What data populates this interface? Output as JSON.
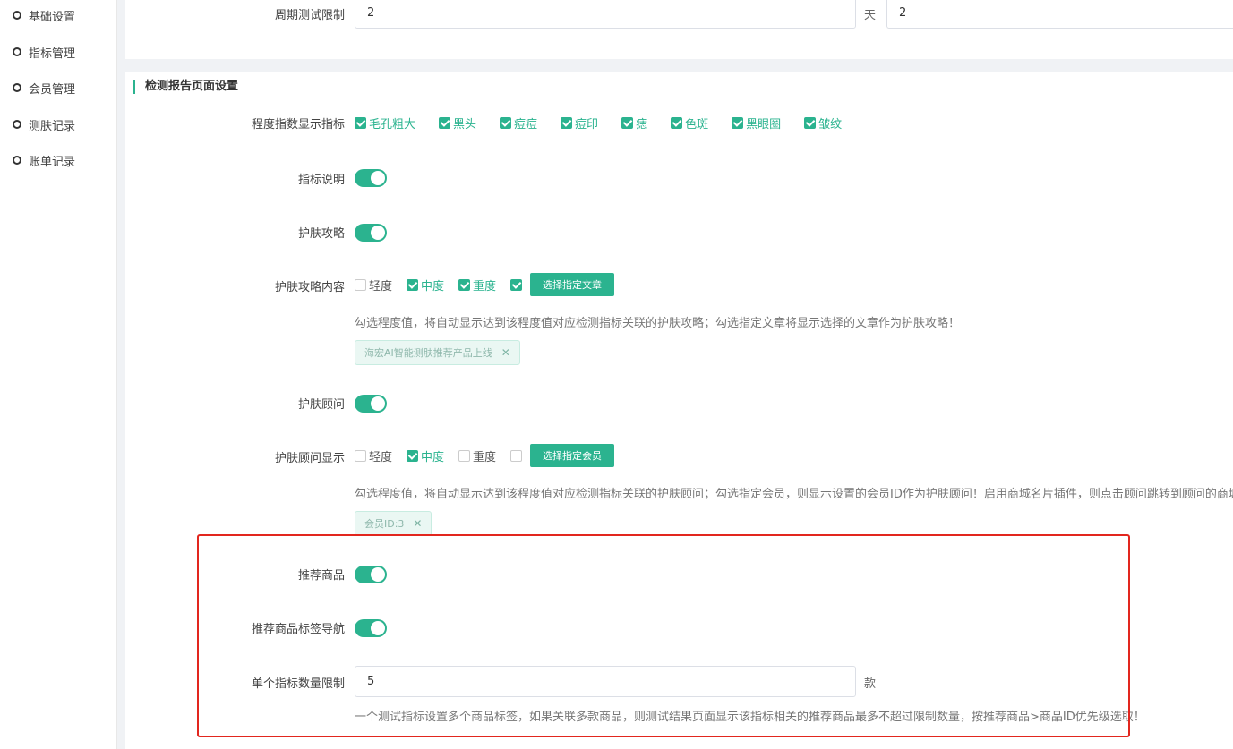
{
  "sidebar": {
    "items": [
      {
        "label": "基础设置"
      },
      {
        "label": "指标管理"
      },
      {
        "label": "会员管理"
      },
      {
        "label": "测肤记录"
      },
      {
        "label": "账单记录"
      }
    ]
  },
  "cycle_limit": {
    "label": "周期测试限制",
    "days_value": "2",
    "unit": "天",
    "count_value": "2"
  },
  "report": {
    "section_title": "检测报告页面设置",
    "degree_index": {
      "label": "程度指数显示指标",
      "options": [
        {
          "label": "毛孔粗大",
          "checked": true
        },
        {
          "label": "黑头",
          "checked": true
        },
        {
          "label": "痘痘",
          "checked": true
        },
        {
          "label": "痘印",
          "checked": true
        },
        {
          "label": "痣",
          "checked": true
        },
        {
          "label": "色斑",
          "checked": true
        },
        {
          "label": "黑眼圈",
          "checked": true
        },
        {
          "label": "皱纹",
          "checked": true
        }
      ]
    },
    "index_desc": {
      "label": "指标说明",
      "on": true
    },
    "skincare_guide": {
      "label": "护肤攻略",
      "on": true
    },
    "guide_content": {
      "label": "护肤攻略内容",
      "options": [
        {
          "label": "轻度",
          "checked": false
        },
        {
          "label": "中度",
          "checked": true
        },
        {
          "label": "重度",
          "checked": true
        }
      ],
      "custom_checked": true,
      "button": "选择指定文章",
      "hint": "勾选程度值，将自动显示达到该程度值对应检测指标关联的护肤攻略；勾选指定文章将显示选择的文章作为护肤攻略！",
      "tag": "海宏AI智能测肤推荐产品上线"
    },
    "advisor": {
      "label": "护肤顾问",
      "on": true
    },
    "advisor_display": {
      "label": "护肤顾问显示",
      "options": [
        {
          "label": "轻度",
          "checked": false
        },
        {
          "label": "中度",
          "checked": true
        },
        {
          "label": "重度",
          "checked": false
        }
      ],
      "custom_checked": false,
      "button": "选择指定会员",
      "hint": "勾选程度值，将自动显示达到该程度值对应检测指标关联的护肤顾问；勾选指定会员，则显示设置的会员ID作为护肤顾问！启用商城名片插件，则点击顾问跳转到顾问的商城名片",
      "tag": "会员ID:3"
    },
    "recommend": {
      "label": "推荐商品",
      "on": true
    },
    "recommend_nav": {
      "label": "推荐商品标签导航",
      "on": true
    },
    "single_limit": {
      "label": "单个指标数量限制",
      "value": "5",
      "unit": "款",
      "hint": "一个测试指标设置多个商品标签，如果关联多款商品，则测试结果页面显示该指标相关的推荐商品最多不超过限制数量，按推荐商品>商品ID优先级选取！"
    }
  },
  "colors": {
    "accent": "#2bb38f",
    "highlight": "#e2261e"
  }
}
